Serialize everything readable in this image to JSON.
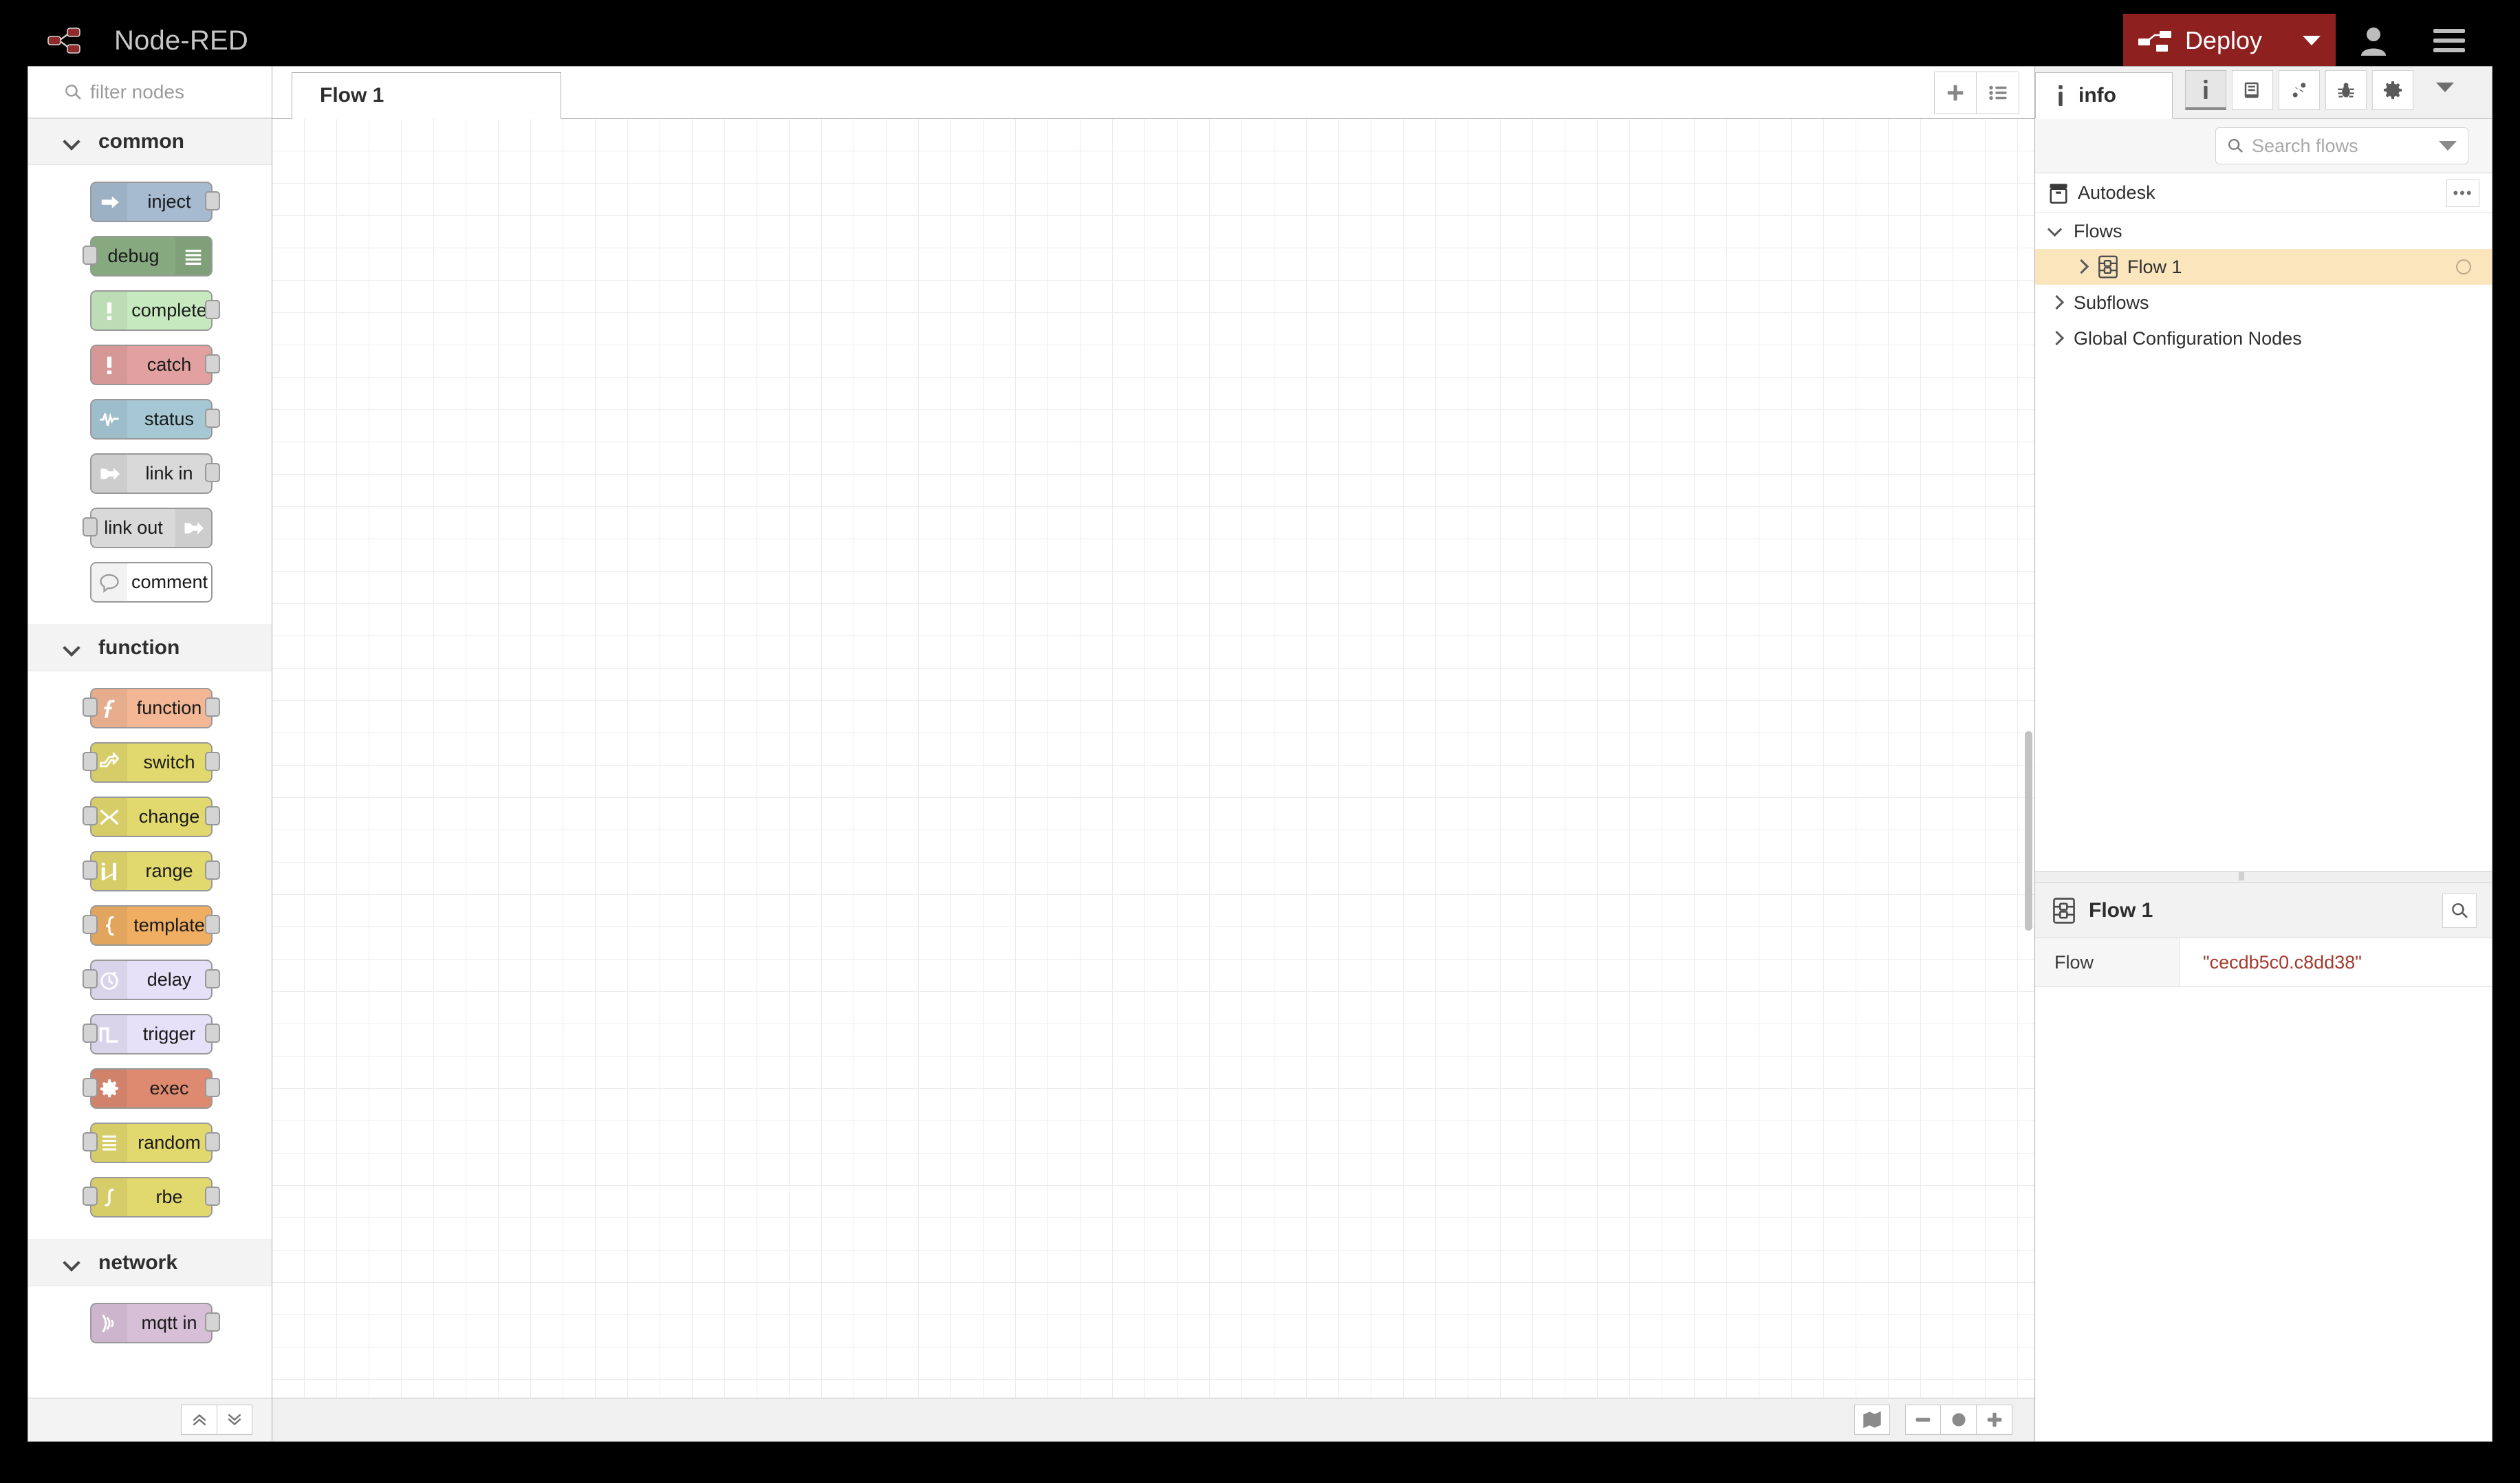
{
  "header": {
    "app_title": "Node-RED",
    "deploy_label": "Deploy",
    "logo_icon": "node-red-logo-icon",
    "deploy_icon": "deploy-nodes-icon",
    "deploy_caret_icon": "chevron-down-icon",
    "user_icon": "user-account-icon",
    "menu_icon": "hamburger-menu-icon",
    "deploy_bg": "#8f2020",
    "bar_bg": "#000000"
  },
  "palette": {
    "search_placeholder": "filter nodes",
    "search_icon": "search-icon",
    "collapse_all_icon": "chevron-double-up-icon",
    "expand_all_icon": "chevron-double-down-icon",
    "categories": [
      {
        "name": "common",
        "expanded": true,
        "nodes": [
          {
            "label": "inject",
            "icon": "inject-arrow-icon",
            "color": "#a6bbcf",
            "ports": [
              "out"
            ],
            "icon_side": "left"
          },
          {
            "label": "debug",
            "icon": "debug-lines-icon",
            "color": "#87a980",
            "ports": [
              "in"
            ],
            "icon_side": "right"
          },
          {
            "label": "complete",
            "icon": "exclamation-icon",
            "color": "#c7e9c0",
            "ports": [
              "out"
            ],
            "icon_side": "left"
          },
          {
            "label": "catch",
            "icon": "exclamation-icon",
            "color": "#e2a0a0",
            "ports": [
              "out"
            ],
            "icon_side": "left"
          },
          {
            "label": "status",
            "icon": "pulse-wave-icon",
            "color": "#a5c8d4",
            "ports": [
              "out"
            ],
            "icon_side": "left"
          },
          {
            "label": "link in",
            "icon": "link-arrow-icon",
            "color": "#d9d9d9",
            "ports": [
              "out"
            ],
            "icon_side": "left"
          },
          {
            "label": "link out",
            "icon": "link-arrow-icon",
            "color": "#d9d9d9",
            "ports": [
              "in"
            ],
            "icon_side": "right"
          },
          {
            "label": "comment",
            "icon": "speech-bubble-icon",
            "color": "#ffffff",
            "ports": [],
            "icon_side": "left"
          }
        ]
      },
      {
        "name": "function",
        "expanded": true,
        "nodes": [
          {
            "label": "function",
            "icon": "function-f-icon",
            "color": "#f3b795",
            "ports": [
              "in",
              "out"
            ],
            "icon_side": "left"
          },
          {
            "label": "switch",
            "icon": "switch-branch-icon",
            "color": "#e2d96e",
            "ports": [
              "in",
              "out"
            ],
            "icon_side": "left"
          },
          {
            "label": "change",
            "icon": "change-swap-icon",
            "color": "#e2d96e",
            "ports": [
              "in",
              "out"
            ],
            "icon_side": "left"
          },
          {
            "label": "range",
            "icon": "range-bars-icon",
            "color": "#e2d96e",
            "ports": [
              "in",
              "out"
            ],
            "icon_side": "left"
          },
          {
            "label": "template",
            "icon": "curly-brace-icon",
            "color": "#efae62",
            "ports": [
              "in",
              "out"
            ],
            "icon_side": "left"
          },
          {
            "label": "delay",
            "icon": "stopwatch-icon",
            "color": "#e6e0f8",
            "ports": [
              "in",
              "out"
            ],
            "icon_side": "left"
          },
          {
            "label": "trigger",
            "icon": "pulse-step-icon",
            "color": "#e6e0f8",
            "ports": [
              "in",
              "out"
            ],
            "icon_side": "left"
          },
          {
            "label": "exec",
            "icon": "gear-icon",
            "color": "#dd8a70",
            "ports": [
              "in",
              "out"
            ],
            "icon_side": "left"
          },
          {
            "label": "random",
            "icon": "list-lines-icon",
            "color": "#e2d96e",
            "ports": [
              "in",
              "out"
            ],
            "icon_side": "left"
          },
          {
            "label": "rbe",
            "icon": "integral-icon",
            "color": "#e2d96e",
            "ports": [
              "in",
              "out"
            ],
            "icon_side": "left"
          }
        ]
      },
      {
        "name": "network",
        "expanded": true,
        "nodes": [
          {
            "label": "mqtt in",
            "icon": "broadcast-waves-icon",
            "color": "#d8bfd8",
            "ports": [
              "out"
            ],
            "icon_side": "left"
          }
        ]
      }
    ]
  },
  "workspace": {
    "tabs": [
      {
        "label": "Flow 1",
        "active": true
      }
    ],
    "add_tab_icon": "plus-icon",
    "list_tabs_icon": "list-bullets-icon",
    "navigator_icon": "map-navigator-icon",
    "zoom_out_icon": "minus-icon",
    "zoom_reset_icon": "circle-icon",
    "zoom_in_icon": "plus-icon"
  },
  "sidebar": {
    "active_tab": "info",
    "tab_icon": "info-i-icon",
    "icon_buttons": [
      {
        "name": "info",
        "icon": "info-i-icon",
        "active": true
      },
      {
        "name": "help",
        "icon": "book-help-icon",
        "active": false
      },
      {
        "name": "context",
        "icon": "git-branch-icon",
        "active": false
      },
      {
        "name": "debug",
        "icon": "bug-icon",
        "active": false
      },
      {
        "name": "config",
        "icon": "gear-icon",
        "active": false
      }
    ],
    "more_icon": "chevron-down-icon",
    "search_placeholder": "Search flows",
    "search_icon": "search-icon",
    "search_caret_icon": "chevron-down-icon",
    "tree": [
      {
        "label": "Autodesk",
        "icon": "project-box-icon",
        "level": 0,
        "chevron": "none",
        "selected": false,
        "has_menu": true
      },
      {
        "label": "Flows",
        "icon": "none",
        "level": 0,
        "chevron": "down",
        "selected": false,
        "has_menu": false
      },
      {
        "label": "Flow 1",
        "icon": "flow-icon",
        "level": 1,
        "chevron": "right",
        "selected": true,
        "has_menu": false,
        "status": "circle"
      },
      {
        "label": "Subflows",
        "icon": "none",
        "level": 0,
        "chevron": "right",
        "selected": false,
        "has_menu": false
      },
      {
        "label": "Global Configuration Nodes",
        "icon": "none",
        "level": 0,
        "chevron": "right",
        "selected": false,
        "has_menu": false
      }
    ],
    "menu_ellipsis": "•••",
    "properties": {
      "title": "Flow 1",
      "title_icon": "flow-icon",
      "search_icon": "search-icon",
      "rows": [
        {
          "key": "Flow",
          "value": "\"cecdb5c0.c8dd38\""
        }
      ]
    },
    "selected_row_bg": "#fbe5bd",
    "value_color": "#a33a2e"
  }
}
